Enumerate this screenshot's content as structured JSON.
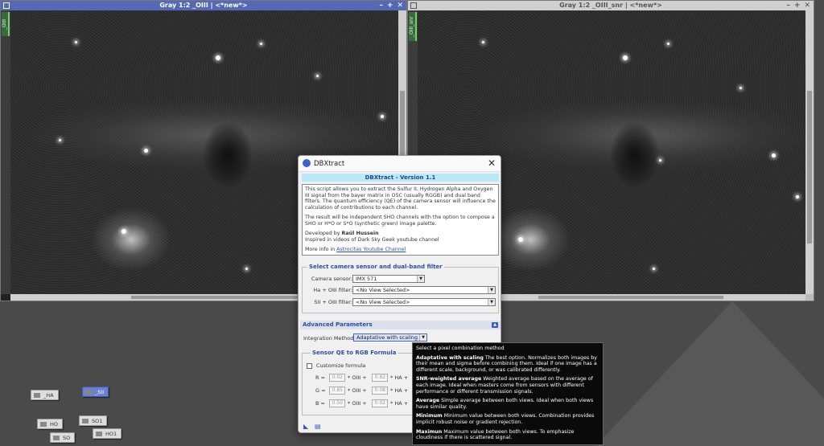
{
  "windows": {
    "left": {
      "title": "Gray 1:2  _OIII | <*new*>",
      "sidetab": "_OIII"
    },
    "right": {
      "title": "Gray 1:2  _OIII_snr | <*new*>",
      "sidetab": "_OIII_snr"
    },
    "title_buttons": [
      "–",
      "+",
      "✕"
    ]
  },
  "workspace_icons": [
    {
      "label": "_HA",
      "selected": false
    },
    {
      "label": "_SII",
      "selected": true
    },
    {
      "label": "HO",
      "selected": false
    },
    {
      "label": "SO1",
      "selected": false
    },
    {
      "label": "SO",
      "selected": false
    },
    {
      "label": "HO1",
      "selected": false
    }
  ],
  "dialog": {
    "title": "DBXtract",
    "banner": "DBXtract - Version 1.1",
    "info": {
      "p1": "This script allows you to extract the Sulfur II, Hydrogen Alpha and Oxygen III signal from the bayer matrix in OSC (usually RGGB) and dual band filters. The quantum efficiency (QE) of the camera sensor will influence the calculation of contributions to each channel.",
      "p2": "The result will be independent SHO channels with the option to compose a SHO or H*O or S*O (synthetic green) image palette.",
      "dev_prefix": "Developed by ",
      "dev_name": "Raúl Hussein",
      "inspired": "Inspired in videos of Dark Sky Geek youtube channel",
      "more_prefix": "More info in ",
      "more_link": "Astrocitas Youtube Channel"
    },
    "sensor_group": {
      "title": "Select camera sensor and dual-band filter",
      "camera_label": "Camera sensor:",
      "camera_value": "IMX 571",
      "ha_label": "Ha + OIII filter:",
      "ha_value": "<No View Selected>",
      "sii_label": "SII + OIII filter:",
      "sii_value": "<No View Selected>"
    },
    "advanced": {
      "title": "Advanced Parameters",
      "integration_label": "Integration Method:",
      "integration_value": "Adaptative with scaling"
    },
    "qe_group": {
      "title": "Sensor QE to RGB Formula",
      "customize_label": "Customize formula",
      "rows": [
        {
          "label": "R =",
          "a": "0.02",
          "b": "0.82"
        },
        {
          "label": "G =",
          "a": "0.85",
          "b": "0.08"
        },
        {
          "label": "B =",
          "a": "0.50",
          "b": "0.02"
        }
      ],
      "oiii_text": "* OIII +",
      "ha_text": "* HA +"
    }
  },
  "tooltip": {
    "heading": "Select a pixel combination method",
    "items": [
      {
        "name": "Adaptative with scaling",
        "desc": " The best option. Normalizes both images by their mean and sigma before combining them. Ideal if one image has a different scale, background, or was calibrated differently."
      },
      {
        "name": "SNR-weighted average",
        "desc": " Weighted average based on the average of each image. Ideal when masters come from sensors with different performance or different transmission signals."
      },
      {
        "name": "Average",
        "desc": " Simple average between both views. Ideal when both views have similar quality."
      },
      {
        "name": "Minimum",
        "desc": " Minimum value between both views. Combination provides implicit robust noise or gradient rejection."
      },
      {
        "name": "Maximun",
        "desc": " Maximum value between both views. To emphasize cloudiness if there is scattered signal."
      }
    ]
  }
}
